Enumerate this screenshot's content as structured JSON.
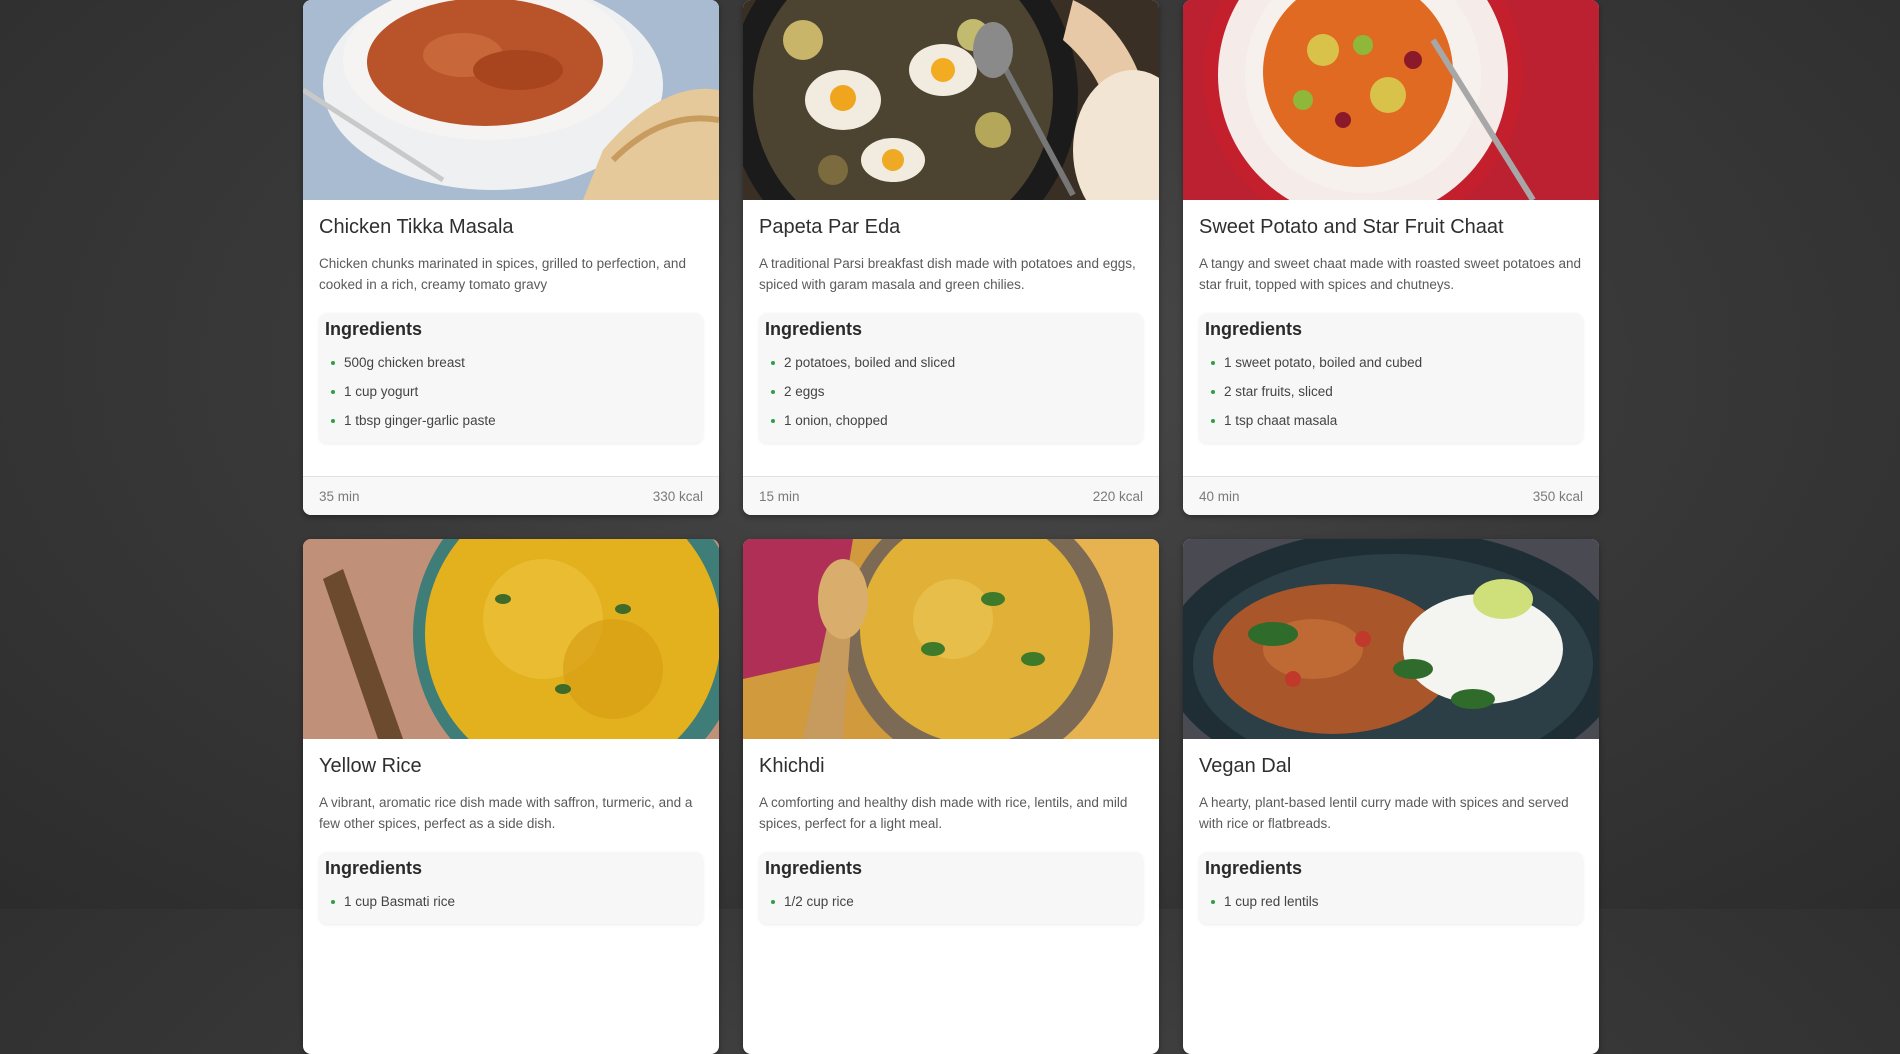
{
  "recipes": [
    {
      "title": "Chicken Tikka Masala",
      "description": "Chicken chunks marinated in spices, grilled to perfection, and cooked in a rich, creamy tomato gravy",
      "ingredients_heading": "Ingredients",
      "ingredients": [
        "500g chicken breast",
        "1 cup yogurt",
        "1 tbsp ginger-garlic paste"
      ],
      "time": "35 min",
      "calories": "330 kcal",
      "image_colors": {
        "bg": "#b9c7d8",
        "dish": "#f4f1ee",
        "food": "#b9532a",
        "accent": "#d9b583"
      }
    },
    {
      "title": "Papeta Par Eda",
      "description": "A traditional Parsi breakfast dish made with potatoes and eggs, spiced with garam masala and green chilies.",
      "ingredients_heading": "Ingredients",
      "ingredients": [
        "2 potatoes, boiled and sliced",
        "2 eggs",
        "1 onion, chopped"
      ],
      "time": "15 min",
      "calories": "220 kcal",
      "image_colors": {
        "bg": "#3a2f25",
        "dish": "#1b1b1b",
        "food": "#c9b56a",
        "accent": "#f2ece0"
      }
    },
    {
      "title": "Sweet Potato and Star Fruit Chaat",
      "description": "A tangy and sweet chaat made with roasted sweet potatoes and star fruit, topped with spices and chutneys.",
      "ingredients_heading": "Ingredients",
      "ingredients": [
        "1 sweet potato, boiled and cubed",
        "2 star fruits, sliced",
        "1 tsp chaat masala"
      ],
      "time": "40 min",
      "calories": "350 kcal",
      "image_colors": {
        "bg": "#b5192b",
        "dish": "#f5ecea",
        "food": "#e06a22",
        "accent": "#8fb83a"
      }
    },
    {
      "title": "Yellow Rice",
      "description": "A vibrant, aromatic rice dish made with saffron, turmeric, and a few other spices, perfect as a side dish.",
      "ingredients_heading": "Ingredients",
      "ingredients": [
        "1 cup Basmati rice"
      ],
      "time": "",
      "calories": "",
      "image_colors": {
        "bg": "#c79a83",
        "dish": "#3f7d78",
        "food": "#e3b01e",
        "accent": "#6b4a2e"
      }
    },
    {
      "title": "Khichdi",
      "description": "A comforting and healthy dish made with rice, lentils, and mild spices, perfect for a light meal.",
      "ingredients_heading": "Ingredients",
      "ingredients": [
        "1/2 cup rice"
      ],
      "time": "",
      "calories": "",
      "image_colors": {
        "bg": "#d19a3d",
        "dish": "#7c6a55",
        "food": "#e0b037",
        "accent": "#b02f56"
      }
    },
    {
      "title": "Vegan Dal",
      "description": "A hearty, plant-based lentil curry made with spices and served with rice or flatbreads.",
      "ingredients_heading": "Ingredients",
      "ingredients": [
        "1 cup red lentils"
      ],
      "time": "",
      "calories": "",
      "image_colors": {
        "bg": "#4a4a52",
        "dish": "#1f2e35",
        "food": "#a8562a",
        "accent": "#f4f4f0"
      }
    }
  ]
}
